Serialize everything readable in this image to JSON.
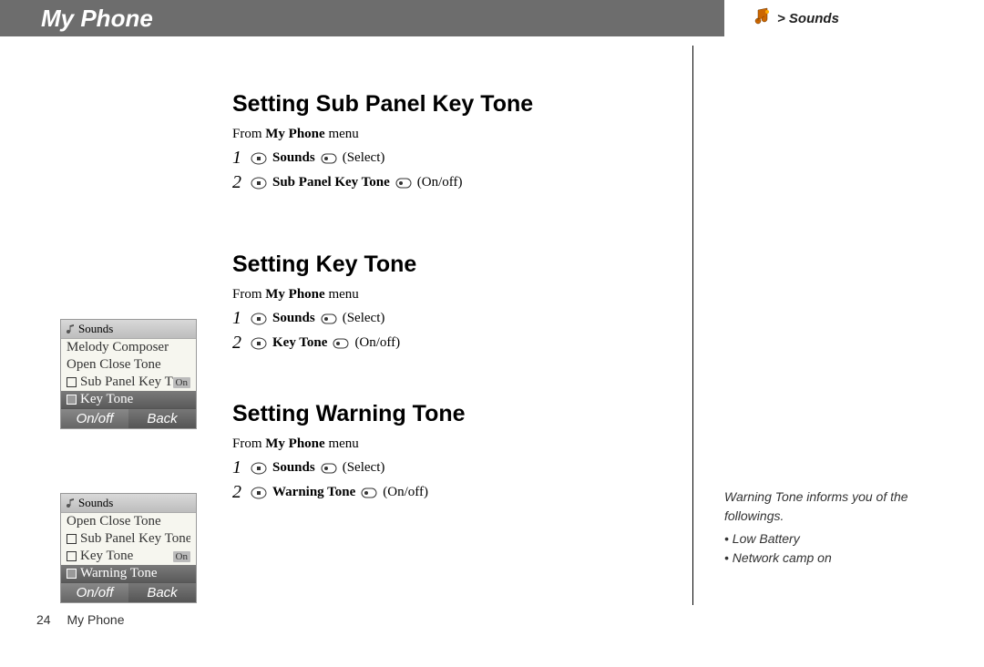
{
  "header": {
    "title": "My Phone"
  },
  "breadcrumb": {
    "text": "> Sounds"
  },
  "sections": [
    {
      "heading": "Setting Sub Panel Key Tone",
      "from_prefix": "From ",
      "from_bold": "My Phone",
      "from_suffix": " menu",
      "steps": [
        {
          "num": "1",
          "label": "Sounds",
          "action": "(Select)"
        },
        {
          "num": "2",
          "label": "Sub Panel Key Tone",
          "action": "(On/off)"
        }
      ]
    },
    {
      "heading": "Setting Key Tone",
      "from_prefix": "From ",
      "from_bold": "My Phone",
      "from_suffix": " menu",
      "steps": [
        {
          "num": "1",
          "label": "Sounds",
          "action": "(Select)"
        },
        {
          "num": "2",
          "label": "Key Tone",
          "action": "(On/off)"
        }
      ]
    },
    {
      "heading": "Setting Warning Tone",
      "from_prefix": "From ",
      "from_bold": "My Phone",
      "from_suffix": " menu",
      "steps": [
        {
          "num": "1",
          "label": "Sounds",
          "action": "(Select)"
        },
        {
          "num": "2",
          "label": "Warning Tone",
          "action": "(On/off)"
        }
      ]
    }
  ],
  "screenshots": [
    {
      "title": "Sounds",
      "rows": [
        {
          "check": false,
          "text": "Melody Composer",
          "tag": ""
        },
        {
          "check": false,
          "text": "Open Close Tone",
          "tag": ""
        },
        {
          "check": true,
          "text": "Sub Panel Key T",
          "tag": "On"
        },
        {
          "check": true,
          "text": "Key Tone",
          "tag": "",
          "highlight": true
        }
      ],
      "soft_left": "On/off",
      "soft_right": "Back"
    },
    {
      "title": "Sounds",
      "rows": [
        {
          "check": false,
          "text": "Open Close Tone",
          "tag": ""
        },
        {
          "check": true,
          "text": "Sub Panel Key Tone",
          "tag": ""
        },
        {
          "check": true,
          "text": "Key Tone",
          "tag": "On"
        },
        {
          "check": true,
          "text": "Warning Tone",
          "tag": "",
          "highlight": true
        }
      ],
      "soft_left": "On/off",
      "soft_right": "Back"
    }
  ],
  "side_note": {
    "lead": "Warning Tone informs you of the followings.",
    "items": [
      "Low Battery",
      "Network camp on"
    ]
  },
  "footer": {
    "page": "24",
    "label": "My Phone"
  }
}
